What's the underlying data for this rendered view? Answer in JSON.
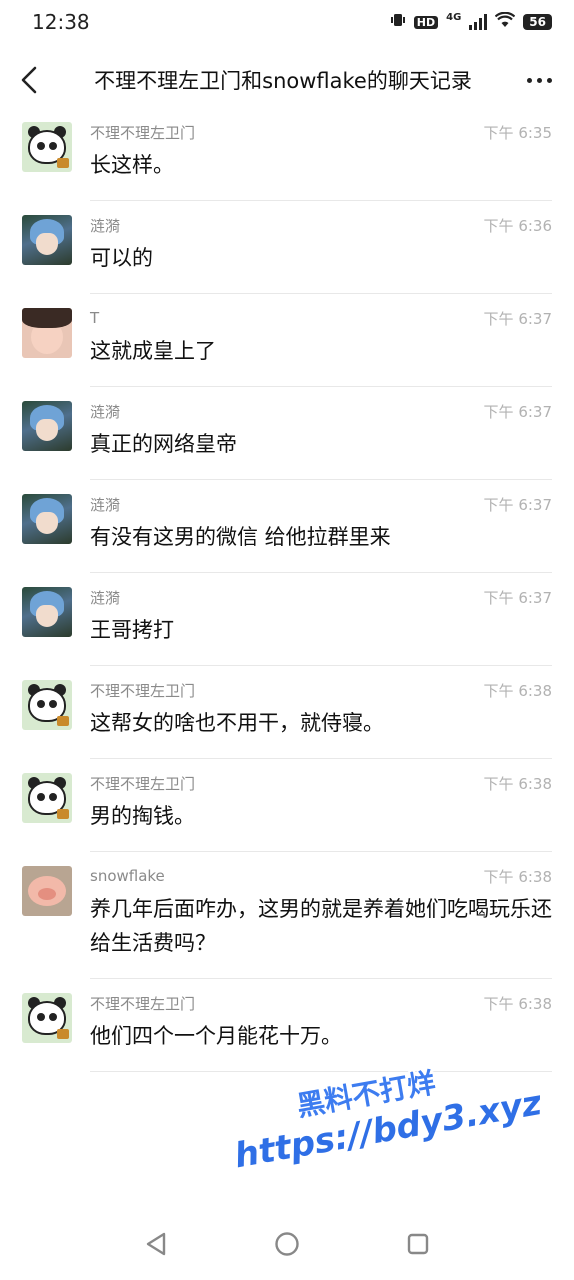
{
  "status_bar": {
    "time": "12:38",
    "hd_label": "HD",
    "network_label": "4G",
    "battery_label": "56"
  },
  "header": {
    "title": "不理不理左卫门和snowflake的聊天记录"
  },
  "messages": [
    {
      "sender": "不理不理左卫门",
      "time": "下午 6:35",
      "text": "长这样。",
      "avatar": "panda"
    },
    {
      "sender": "涟漪",
      "time": "下午 6:36",
      "text": "可以的",
      "avatar": "anime"
    },
    {
      "sender": "T",
      "time": "下午 6:37",
      "text": "这就成皇上了",
      "avatar": "girl"
    },
    {
      "sender": "涟漪",
      "time": "下午 6:37",
      "text": "真正的网络皇帝",
      "avatar": "anime"
    },
    {
      "sender": "涟漪",
      "time": "下午 6:37",
      "text": "有没有这男的微信 给他拉群里来",
      "avatar": "anime"
    },
    {
      "sender": "涟漪",
      "time": "下午 6:37",
      "text": "王哥拷打",
      "avatar": "anime"
    },
    {
      "sender": "不理不理左卫门",
      "time": "下午 6:38",
      "text": "这帮女的啥也不用干，就侍寝。",
      "avatar": "panda"
    },
    {
      "sender": "不理不理左卫门",
      "time": "下午 6:38",
      "text": "男的掏钱。",
      "avatar": "panda"
    },
    {
      "sender": "snowflake",
      "time": "下午 6:38",
      "text": "养几年后面咋办，这男的就是养着她们吃喝玩乐还给生活费吗？",
      "avatar": "pig"
    },
    {
      "sender": "不理不理左卫门",
      "time": "下午 6:38",
      "text": "他们四个一个月能花十万。",
      "avatar": "panda"
    }
  ],
  "watermark": {
    "line1": "黑料不打烊",
    "line2": "https://bdy3.xyz"
  }
}
